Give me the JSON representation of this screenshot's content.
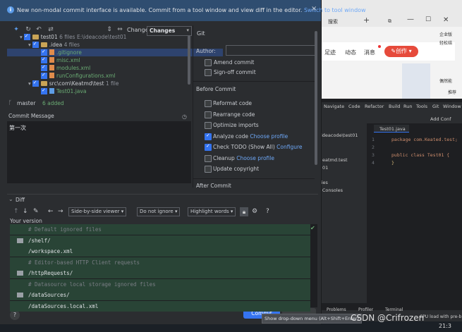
{
  "banner": {
    "text": "New non-modal commit interface is available. Commit from a tool window and view diff in the editor.",
    "link": "Switch to tool window",
    "close": "×"
  },
  "toolbar": {
    "changelist_label": "Changelist:",
    "changelist_value": "Changes",
    "git_tab": "Git"
  },
  "tree": [
    {
      "text": "test01",
      "extra": "6 files  E:\\ideacode\\test01",
      "indent": 18,
      "type": "folder",
      "checked": true
    },
    {
      "text": ".idea",
      "extra": "4 files",
      "indent": 30,
      "type": "folder",
      "checked": true
    },
    {
      "text": ".gitignore",
      "extra": "",
      "indent": 48,
      "type": "file",
      "checked": true,
      "selected": true
    },
    {
      "text": "misc.xml",
      "extra": "",
      "indent": 48,
      "type": "file",
      "checked": true
    },
    {
      "text": "modules.xml",
      "extra": "",
      "indent": 48,
      "type": "file",
      "checked": true
    },
    {
      "text": "runConfigurations.xml",
      "extra": "",
      "indent": 48,
      "type": "file",
      "checked": true
    },
    {
      "text": "src\\com\\Keatmd\\test",
      "extra": "1 file",
      "indent": 30,
      "type": "folder",
      "checked": true
    },
    {
      "text": "Test01.java",
      "extra": "",
      "indent": 48,
      "type": "javafile",
      "checked": true
    }
  ],
  "status": {
    "branch": "master",
    "added": "6 added"
  },
  "commit_message": {
    "label": "Commit Message",
    "value": "第一次"
  },
  "git_panel": {
    "author_label": "Author:",
    "author_value": "",
    "amend_commit": "Amend commit",
    "signoff_commit": "Sign-off commit",
    "before_commit_header": "Before Commit",
    "before_commit": [
      {
        "label": "Reformat code",
        "link": "",
        "checked": false
      },
      {
        "label": "Rearrange code",
        "link": "",
        "checked": false
      },
      {
        "label": "Optimize imports",
        "link": "",
        "checked": false
      },
      {
        "label": "Analyze code",
        "link": "Choose profile",
        "checked": true
      },
      {
        "label": "Check TODO (Show All)",
        "link": "Configure",
        "checked": true
      },
      {
        "label": "Cleanup",
        "link": "Choose profile",
        "checked": false
      },
      {
        "label": "Update copyright",
        "link": "",
        "checked": false
      }
    ],
    "after_commit_header": "After Commit"
  },
  "diff": {
    "header": "Diff",
    "viewer": "Side-by-side viewer",
    "ignore": "Do not ignore",
    "highlight": "Highlight words",
    "help": "?",
    "your_version": "Your version",
    "lines": [
      {
        "text": "# Default ignored files",
        "comment": true,
        "icon": false
      },
      {
        "text": "/shelf/",
        "comment": false,
        "icon": true
      },
      {
        "text": "/workspace.xml",
        "comment": false,
        "icon": false
      },
      {
        "text": "# Editor-based HTTP Client requests",
        "comment": true,
        "icon": false
      },
      {
        "text": "/httpRequests/",
        "comment": false,
        "icon": true
      },
      {
        "text": "# Datasource local storage ignored files",
        "comment": true,
        "icon": false
      },
      {
        "text": "/dataSources/",
        "comment": false,
        "icon": true
      },
      {
        "text": "/dataSources.local.xml",
        "comment": false,
        "icon": false
      }
    ]
  },
  "footer": {
    "help": "?",
    "commit_button": "Commit",
    "tooltip": "Show drop-down menu (Alt+Shift+Enter)"
  },
  "background_browser": {
    "tab_text": "搜索",
    "nav_items": [
      "足迹",
      "动态",
      "消息"
    ],
    "create_button": "创作",
    "side_texts": [
      "企业版",
      "轻松结",
      "偶然能",
      "推荐"
    ]
  },
  "background_ide": {
    "menu": [
      "Navigate",
      "Code",
      "Refactor",
      "Build",
      "Run",
      "Tools",
      "Git",
      "Window"
    ],
    "tab": "Test01.java",
    "add_conf": "Add Conf",
    "project_path": "ideacode\\test01",
    "left_items": [
      "eatmd.test",
      "01",
      "ries",
      "l Consoles"
    ],
    "line_numbers": [
      "1",
      "2",
      "3",
      "4"
    ],
    "code_line1": "package com.Keated.test;",
    "code_line3": "public class Test01 {",
    "code_line4": "}",
    "bottom_tabs": [
      "Problems",
      "Profiler",
      "Terminal"
    ],
    "status_text": "CPU load with pre-b"
  },
  "watermark": "CSDN @Crifrozen",
  "taskbar_time": "21:3"
}
